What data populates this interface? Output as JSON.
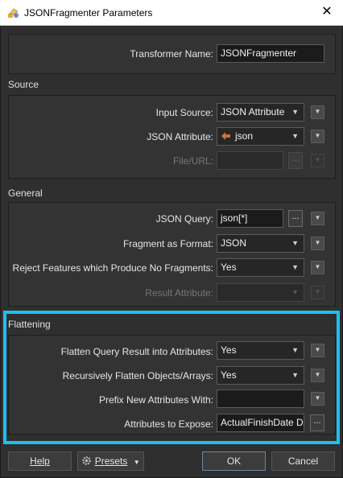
{
  "window": {
    "title": "JSONFragmenter Parameters",
    "close_glyph": "✕"
  },
  "transformer_name": {
    "label": "Transformer Name:",
    "value": "JSONFragmenter"
  },
  "source": {
    "heading": "Source",
    "input_source": {
      "label": "Input Source:",
      "value": "JSON Attribute"
    },
    "json_attribute": {
      "label": "JSON Attribute:",
      "value": "json"
    },
    "file_url": {
      "label": "File/URL:",
      "value": "",
      "enabled": false
    }
  },
  "general": {
    "heading": "General",
    "json_query": {
      "label": "JSON Query:",
      "value": "json[*]"
    },
    "fragment_format": {
      "label": "Fragment as Format:",
      "value": "JSON"
    },
    "reject_features": {
      "label": "Reject Features which Produce No Fragments:",
      "value": "Yes"
    },
    "result_attribute": {
      "label": "Result Attribute:",
      "value": "",
      "enabled": false
    }
  },
  "flattening": {
    "heading": "Flattening",
    "flatten_query": {
      "label": "Flatten Query Result into Attributes:",
      "value": "Yes"
    },
    "recursive_flatten": {
      "label": "Recursively Flatten Objects/Arrays:",
      "value": "Yes"
    },
    "prefix": {
      "label": "Prefix New Attributes With:",
      "value": ""
    },
    "attributes_expose": {
      "label": "Attributes to Expose:",
      "value": "ActualFinishDate Da"
    }
  },
  "buttons": {
    "help": "Help",
    "presets": "Presets",
    "ok": "OK",
    "cancel": "Cancel"
  },
  "colors": {
    "highlight": "#1ec0f0",
    "background": "#2f2f2f",
    "attribute_icon": "#c8743a"
  },
  "icons": {
    "dropdown_arrow": "▼",
    "ellipsis": "...",
    "app_icon": "fme-transformer-icon",
    "attribute_icon": "attribute-icon",
    "presets_icon": "gear-icon"
  }
}
